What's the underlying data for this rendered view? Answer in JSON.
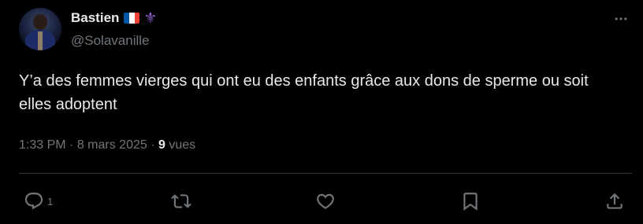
{
  "tweet": {
    "author": {
      "display_name": "Bastien",
      "handle": "@Solavanille",
      "flag_icon": "france-flag-icon",
      "badge_icon": "fleur-de-lis-icon"
    },
    "text": "Y’a des femmes vierges qui ont eu des enfants grâce aux dons de sperme ou soit elles adoptent",
    "meta": {
      "time": "1:33 PM",
      "sep1": "·",
      "date": "8 mars 2025",
      "sep2": "·",
      "views_count": "9",
      "views_label": "vues"
    },
    "actions": {
      "reply_count": "1"
    }
  },
  "colors": {
    "background": "#000000",
    "primary_text": "#e7e9ea",
    "secondary_text": "#71767b",
    "divider": "#2f3336",
    "flag_blue": "#0055a4",
    "flag_white": "#ffffff",
    "flag_red": "#ef4135",
    "fleur": "#8a5cc8"
  }
}
